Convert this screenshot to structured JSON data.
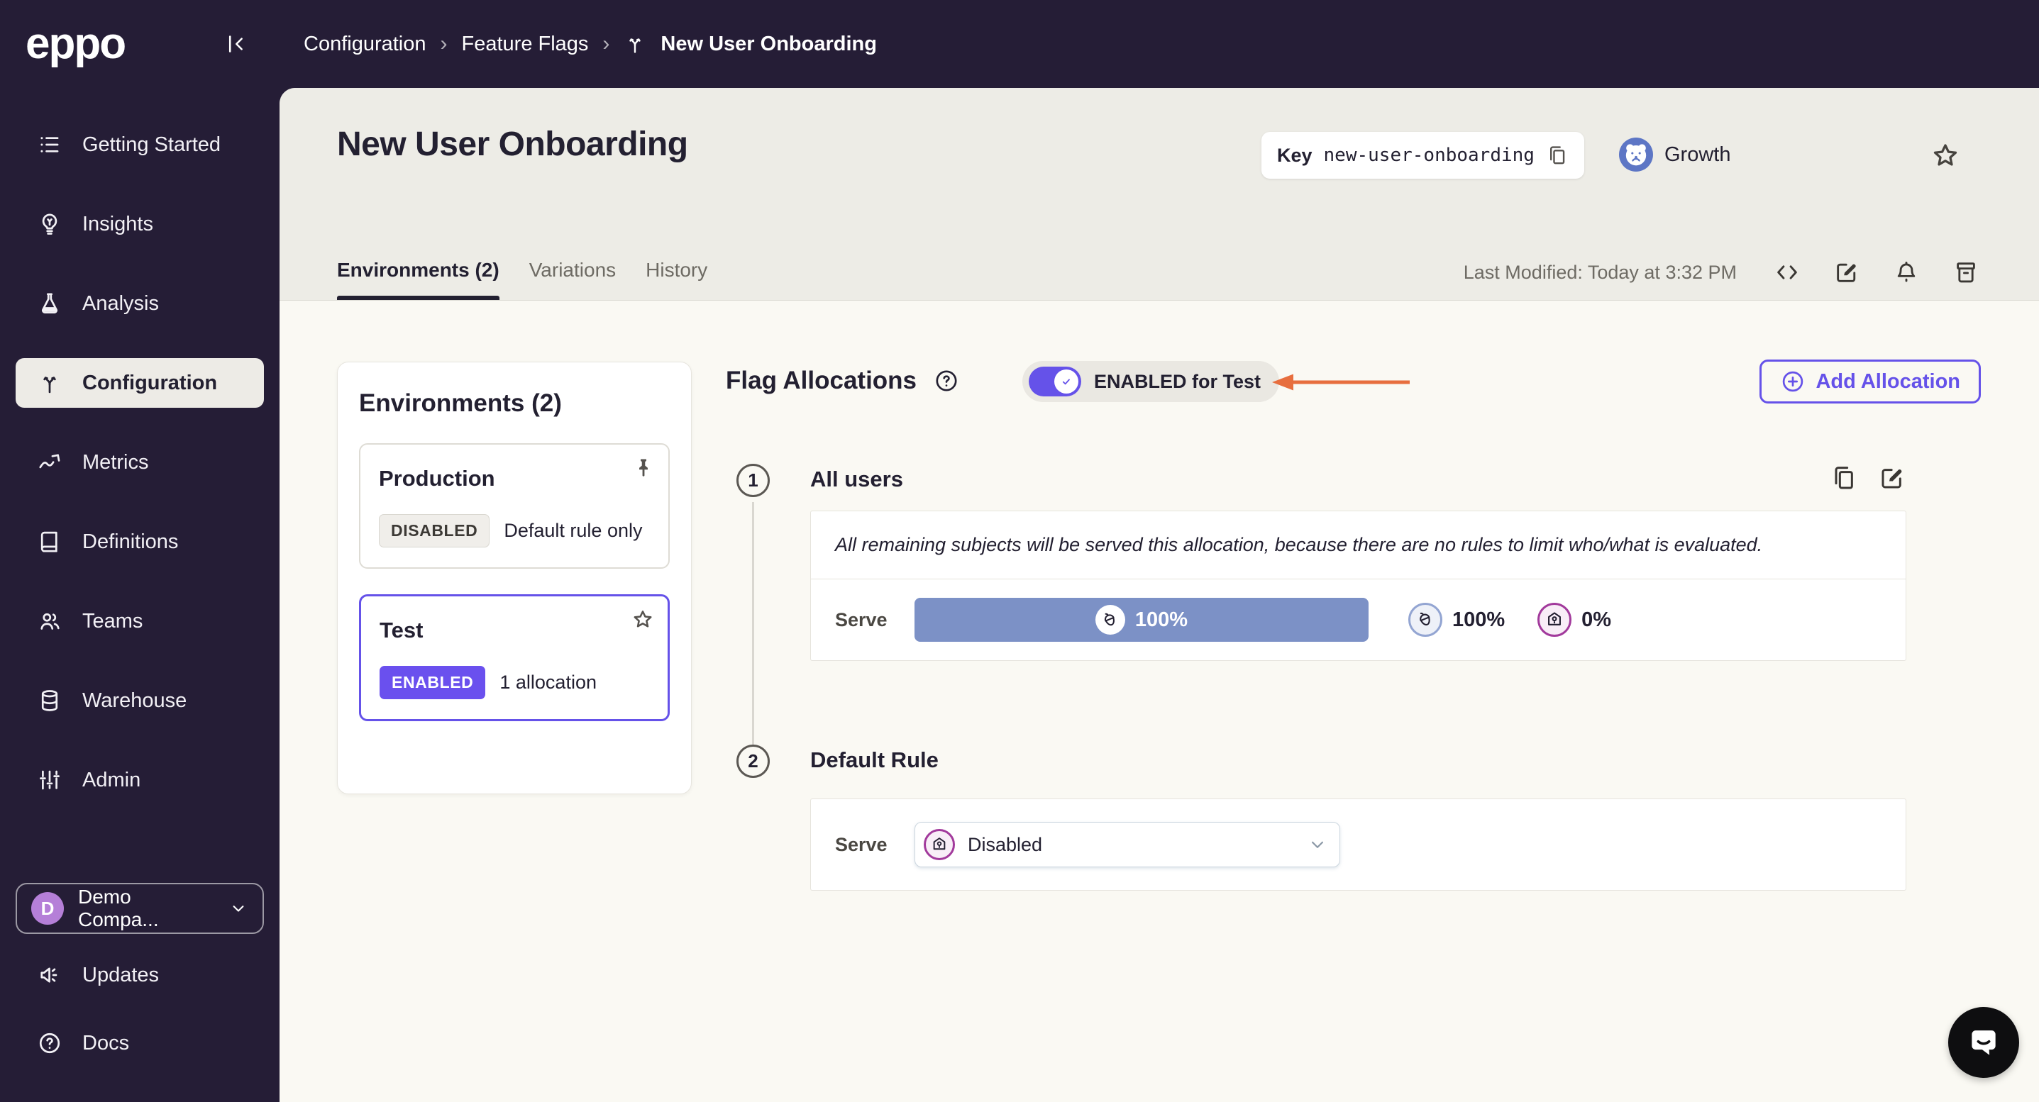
{
  "brand": {
    "logo_text": "eppo"
  },
  "breadcrumb": {
    "items": [
      {
        "label": "Configuration"
      },
      {
        "label": "Feature Flags"
      },
      {
        "label": "New User Onboarding"
      }
    ]
  },
  "sidebar": {
    "items": [
      {
        "label": "Getting Started",
        "icon": "list-icon"
      },
      {
        "label": "Insights",
        "icon": "lightbulb-icon"
      },
      {
        "label": "Analysis",
        "icon": "flask-icon"
      },
      {
        "label": "Configuration",
        "icon": "split-arrows-icon",
        "active": true
      },
      {
        "label": "Metrics",
        "icon": "line-chart-icon"
      },
      {
        "label": "Definitions",
        "icon": "book-icon"
      },
      {
        "label": "Teams",
        "icon": "people-icon"
      },
      {
        "label": "Warehouse",
        "icon": "database-icon"
      },
      {
        "label": "Admin",
        "icon": "sliders-icon"
      }
    ],
    "workspace": {
      "initial": "D",
      "name": "Demo Compa..."
    },
    "footer_items": [
      {
        "label": "Updates",
        "icon": "megaphone-icon"
      },
      {
        "label": "Docs",
        "icon": "question-circle-icon"
      }
    ]
  },
  "header": {
    "title": "New User Onboarding",
    "key_label": "Key",
    "key_value": "new-user-onboarding",
    "team_name": "Growth"
  },
  "tabs": {
    "items": [
      {
        "label": "Environments (2)",
        "active": true
      },
      {
        "label": "Variations"
      },
      {
        "label": "History"
      }
    ],
    "last_modified": "Last Modified: Today at 3:32 PM"
  },
  "environments_panel": {
    "title": "Environments (2)",
    "cards": [
      {
        "name": "Production",
        "status": "DISABLED",
        "detail": "Default rule only",
        "corner_icon": "pin-icon"
      },
      {
        "name": "Test",
        "status": "ENABLED",
        "detail": "1 allocation",
        "corner_icon": "star-icon",
        "selected": true
      }
    ]
  },
  "allocations": {
    "title": "Flag Allocations",
    "toggle_label": "ENABLED for Test",
    "add_button_label": "Add Allocation",
    "steps": [
      {
        "number": "1",
        "title": "All users",
        "description": "All remaining subjects will be served this allocation, because there are no rules to limit who/what is evaluated.",
        "serve_label": "Serve",
        "bar_percent": "100%",
        "legend": [
          {
            "value": "100%",
            "variation": "enabled",
            "icon": "acorn-icon"
          },
          {
            "value": "0%",
            "variation": "disabled",
            "icon": "birdhouse-icon"
          }
        ]
      },
      {
        "number": "2",
        "title": "Default Rule",
        "serve_label": "Serve",
        "dropdown_value": "Disabled"
      }
    ]
  },
  "icons": [
    "collapse-sidebar-icon",
    "chevron-right-icon",
    "flag-split-icon",
    "copy-icon",
    "bear-avatar-icon",
    "star-icon",
    "code-icon",
    "edit-icon",
    "bell-icon",
    "archive-icon",
    "question-circle-icon",
    "check-icon",
    "plus-circle-icon",
    "pin-icon",
    "acorn-icon",
    "birdhouse-icon",
    "chevron-down-icon",
    "chat-bubble-icon",
    "arrow-left-annotation"
  ],
  "colors": {
    "accent_purple": "#6552e9",
    "enabled_chip": "#6a50ee",
    "serve_bar_blue": "#7c91c6",
    "annotation_orange": "#e76e3e",
    "topbar_dark": "#251d36",
    "header_beige": "#edece6",
    "content_bg": "#faf9f3"
  }
}
